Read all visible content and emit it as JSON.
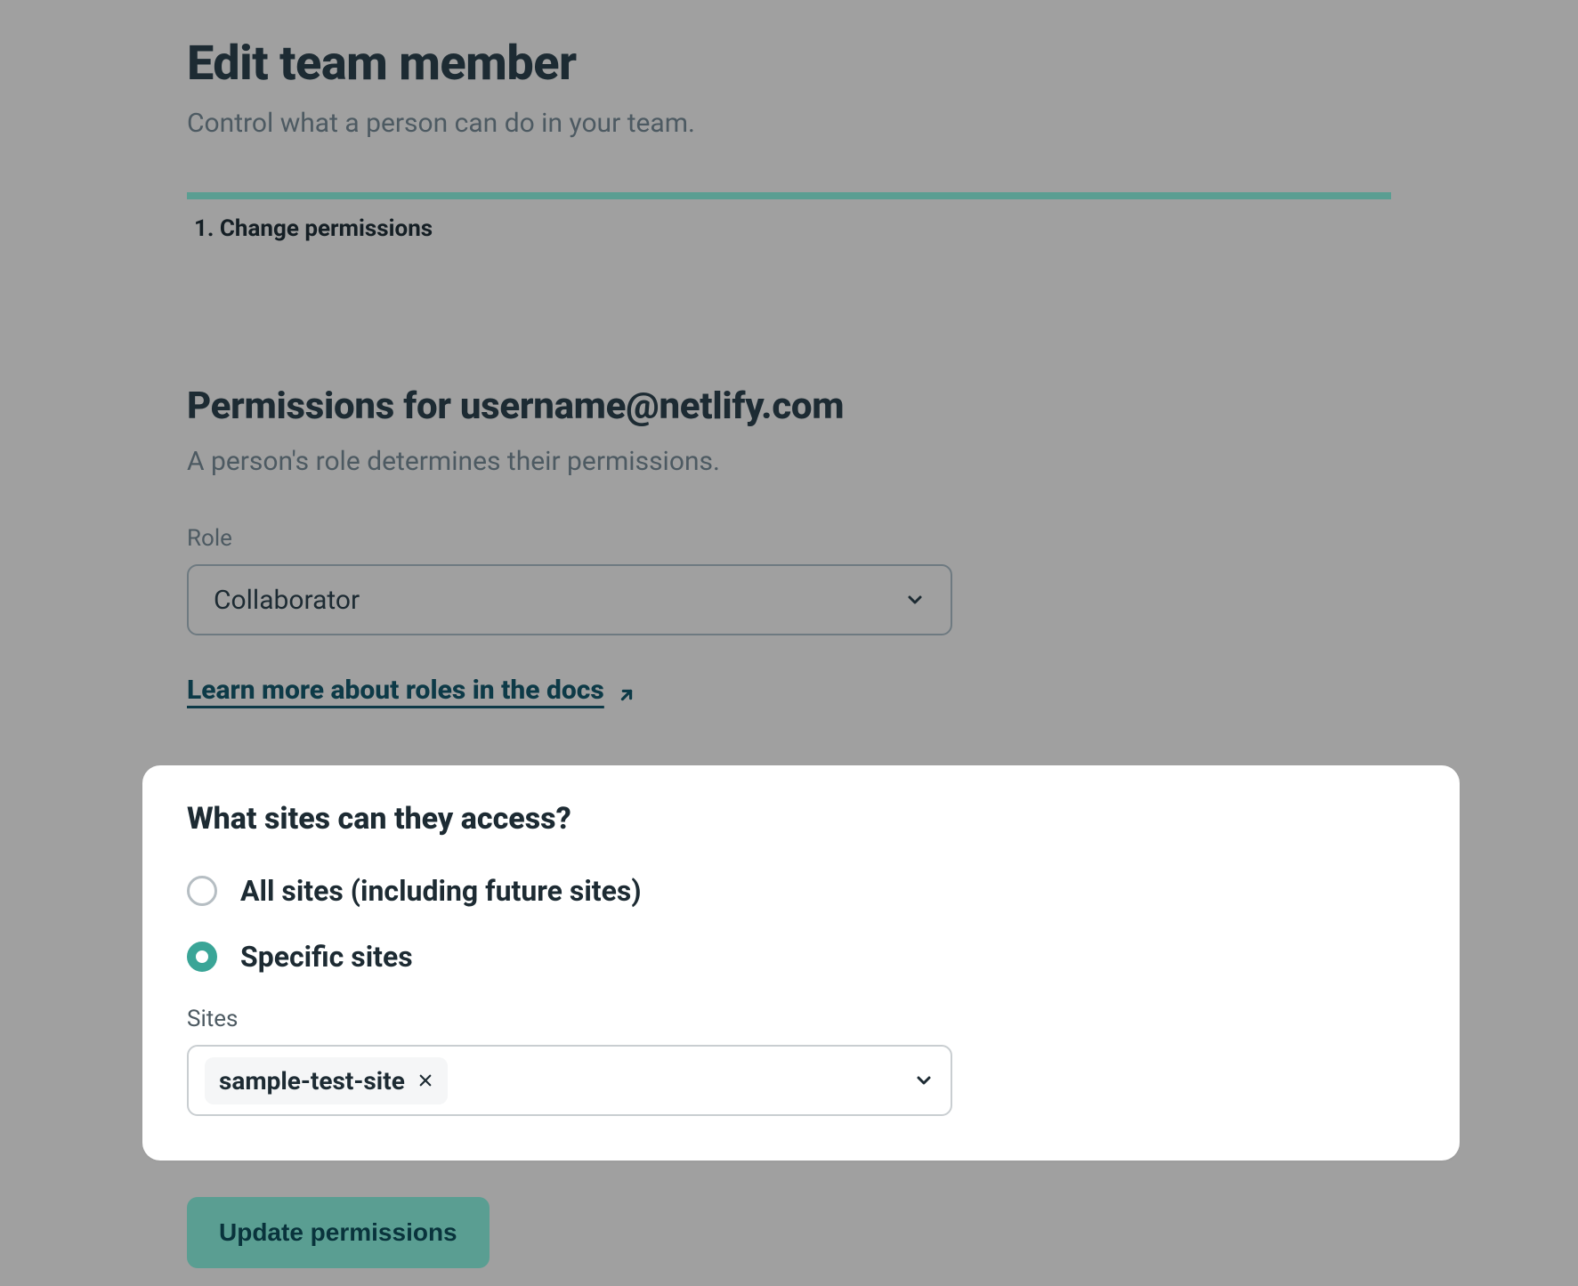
{
  "header": {
    "title": "Edit team member",
    "subtitle": "Control what a person can do in your team."
  },
  "step": {
    "label": "1. Change permissions"
  },
  "permissions": {
    "title": "Permissions for username@netlify.com",
    "subtitle": "A person's role determines their permissions.",
    "role_label": "Role",
    "role_value": "Collaborator",
    "docs_link_text": "Learn more about roles in the docs"
  },
  "sites_access": {
    "title": "What sites can they access?",
    "options": {
      "all_label": "All sites (including future sites)",
      "specific_label": "Specific sites",
      "selected": "specific"
    },
    "sites_field_label": "Sites",
    "selected_sites": [
      {
        "name": "sample-test-site"
      }
    ]
  },
  "actions": {
    "update_label": "Update permissions"
  },
  "colors": {
    "accent": "#5a9e92",
    "teal_radio": "#3aa597",
    "link": "#0d3a47"
  }
}
